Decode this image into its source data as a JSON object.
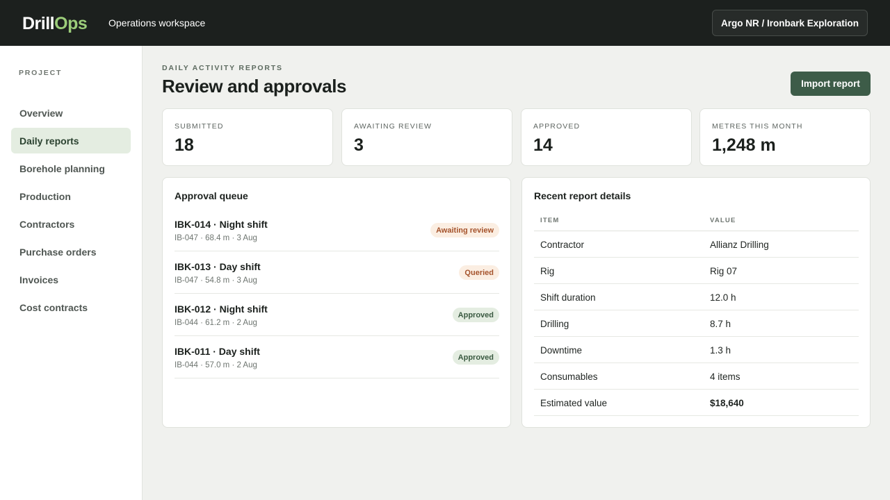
{
  "topbar": {
    "logo_part1": "Drill",
    "logo_part2": "Ops",
    "workspace": "Operations workspace",
    "org_label": "Argo NR / Ironbark Exploration"
  },
  "sidebar": {
    "section_label": "PROJECT",
    "items": [
      {
        "label": "Overview",
        "active": false
      },
      {
        "label": "Daily reports",
        "active": true
      },
      {
        "label": "Borehole planning",
        "active": false
      },
      {
        "label": "Production",
        "active": false
      },
      {
        "label": "Contractors",
        "active": false
      },
      {
        "label": "Purchase orders",
        "active": false
      },
      {
        "label": "Invoices",
        "active": false
      },
      {
        "label": "Cost contracts",
        "active": false
      }
    ]
  },
  "header": {
    "eyebrow": "DAILY ACTIVITY REPORTS",
    "title": "Review and approvals",
    "import_label": "Import report"
  },
  "stats": [
    {
      "label": "SUBMITTED",
      "value": "18"
    },
    {
      "label": "AWAITING REVIEW",
      "value": "3"
    },
    {
      "label": "APPROVED",
      "value": "14"
    },
    {
      "label": "METRES THIS MONTH",
      "value": "1,248 m"
    }
  ],
  "queue": {
    "title": "Approval queue",
    "rows": [
      {
        "title": "IBK-014 · Night shift",
        "meta": "IB-047 · 68.4 m · 3 Aug",
        "status": "Awaiting review",
        "status_type": "warn"
      },
      {
        "title": "IBK-013 · Day shift",
        "meta": "IB-047 · 54.8 m · 3 Aug",
        "status": "Queried",
        "status_type": "warn"
      },
      {
        "title": "IBK-012 · Night shift",
        "meta": "IB-044 · 61.2 m · 2 Aug",
        "status": "Approved",
        "status_type": "ok"
      },
      {
        "title": "IBK-011 · Day shift",
        "meta": "IB-044 · 57.0 m · 2 Aug",
        "status": "Approved",
        "status_type": "ok"
      }
    ]
  },
  "details": {
    "title": "Recent report details",
    "col_item": "ITEM",
    "col_value": "VALUE",
    "rows": [
      {
        "item": "Contractor",
        "value": "Allianz Drilling"
      },
      {
        "item": "Rig",
        "value": "Rig 07"
      },
      {
        "item": "Shift duration",
        "value": "12.0 h"
      },
      {
        "item": "Drilling",
        "value": "8.7 h"
      },
      {
        "item": "Downtime",
        "value": "1.3 h"
      },
      {
        "item": "Consumables",
        "value": "4 items"
      },
      {
        "item": "Estimated value",
        "value": "$18,640"
      }
    ]
  },
  "colors": {
    "topbar": "#1c201e",
    "brand_accent": "#9ccd7a",
    "primary_button": "#3d5c48",
    "badge_warn_bg": "#fbeee2",
    "badge_ok_bg": "#e4ede1"
  }
}
